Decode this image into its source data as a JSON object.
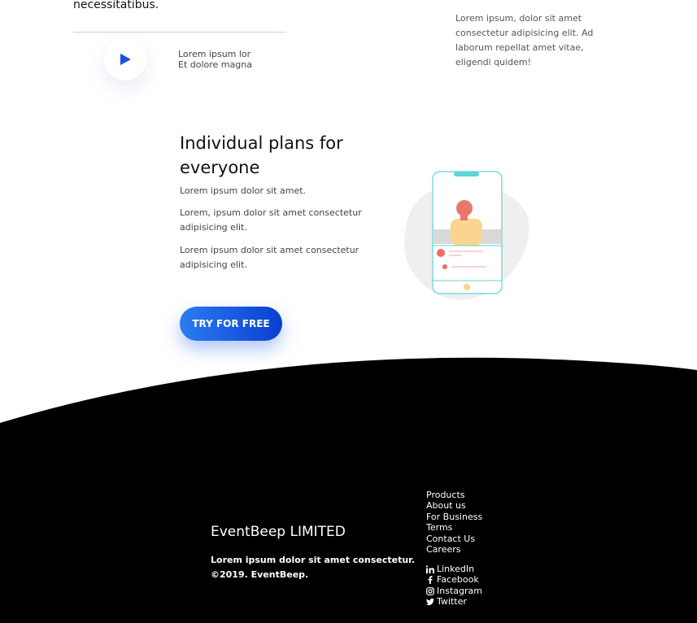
{
  "intro": {
    "heading_fragment": "necessitatibus.",
    "play_lines": [
      "Lorem ipsum lor",
      "Et dolore magna"
    ],
    "side_paragraph": "Lorem ipsum, dolor sit amet consectetur adipisicing elit. Ad laborum repellat amet vitae, eligendi quidem!"
  },
  "plans": {
    "title": "Individual plans for everyone",
    "paragraphs": [
      "Lorem ipsum dolor sit amet.",
      "Lorem, ipsum dolor sit amet consectetur adipisicing elit.",
      "Lorem ipsum dolor sit amet consectetur adipisicing elit."
    ],
    "cta_label": "TRY FOR FREE"
  },
  "footer": {
    "brand": "EventBeep LIMITED",
    "description": "Lorem ipsum dolor sit amet consectetur.",
    "copyright": "©2019. EventBeep.",
    "links": [
      "Products",
      "About us",
      "For Business",
      "Terms",
      "Contact Us",
      "Careers"
    ],
    "socials": [
      {
        "label": "LinkedIn",
        "icon": "linkedin-icon"
      },
      {
        "label": "Facebook",
        "icon": "facebook-icon"
      },
      {
        "label": "Instagram",
        "icon": "instagram-icon"
      },
      {
        "label": "Twitter",
        "icon": "twitter-icon"
      }
    ]
  },
  "colors": {
    "accent_blue": "#1a4fe0",
    "button_gradient_start": "#2b7cf0",
    "button_gradient_end": "#0a3ed0",
    "footer_bg": "#000000",
    "phone_outline": "#5fd3d8"
  }
}
